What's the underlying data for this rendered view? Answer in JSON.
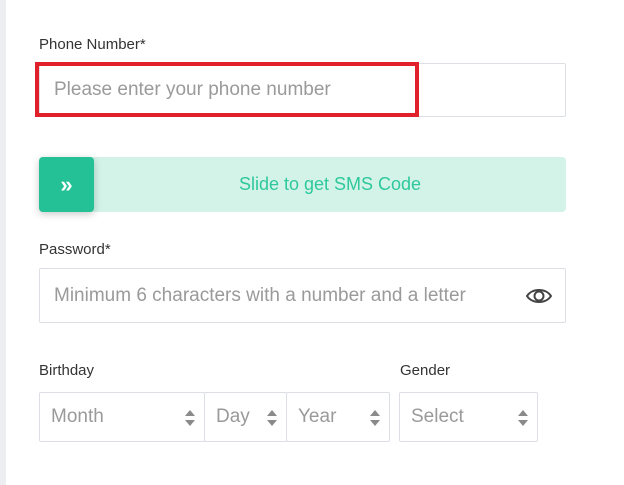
{
  "form": {
    "phone": {
      "label": "Phone Number*",
      "placeholder": "Please enter your phone number",
      "value": ""
    },
    "sms_slider": {
      "handle_glyph": "»",
      "label": "Slide to get SMS Code"
    },
    "password": {
      "label": "Password*",
      "placeholder": "Minimum 6 characters with a number and a letter",
      "value": "",
      "toggle_icon": "eye-icon"
    },
    "birthday": {
      "label": "Birthday",
      "month_placeholder": "Month",
      "day_placeholder": "Day",
      "year_placeholder": "Year"
    },
    "gender": {
      "label": "Gender",
      "placeholder": "Select"
    }
  },
  "colors": {
    "accent": "#25c196",
    "slider_track": "#d3f3e8",
    "highlight": "#e0202a",
    "border": "#dcdfe4",
    "placeholder": "#9a9a9a"
  }
}
